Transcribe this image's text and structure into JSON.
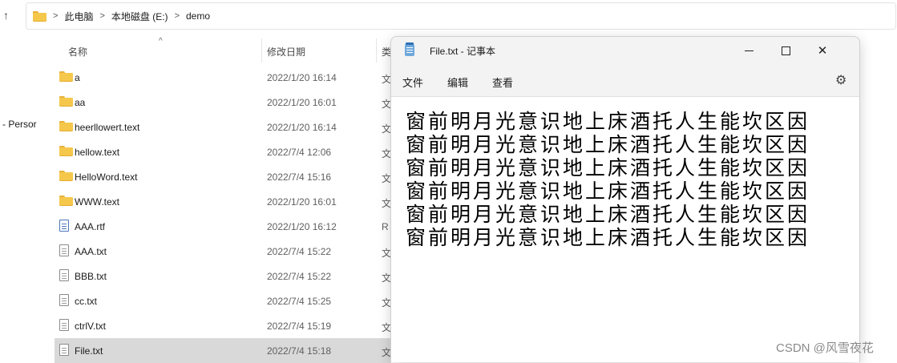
{
  "explorer": {
    "breadcrumb": [
      "此电脑",
      "本地磁盘 (E:)",
      "demo"
    ],
    "left_nav_text": "- Persor",
    "columns": {
      "name": "名称",
      "date": "修改日期",
      "type": "类"
    },
    "files": [
      {
        "name": "a",
        "date": "2022/1/20 16:14",
        "type": "文",
        "icon": "folder-icon"
      },
      {
        "name": "aa",
        "date": "2022/1/20 16:01",
        "type": "文",
        "icon": "folder-icon"
      },
      {
        "name": "heerllowert.text",
        "date": "2022/1/20 16:14",
        "type": "文",
        "icon": "folder-icon"
      },
      {
        "name": "hellow.text",
        "date": "2022/7/4 12:06",
        "type": "文",
        "icon": "folder-icon"
      },
      {
        "name": "HelloWord.text",
        "date": "2022/7/4 15:16",
        "type": "文",
        "icon": "folder-icon"
      },
      {
        "name": "WWW.text",
        "date": "2022/1/20 16:01",
        "type": "文",
        "icon": "folder-icon"
      },
      {
        "name": "AAA.rtf",
        "date": "2022/1/20 16:12",
        "type": "R",
        "icon": "rtf-file-icon"
      },
      {
        "name": "AAA.txt",
        "date": "2022/7/4 15:22",
        "type": "文",
        "icon": "text-file-icon"
      },
      {
        "name": "BBB.txt",
        "date": "2022/7/4 15:22",
        "type": "文",
        "icon": "text-file-icon"
      },
      {
        "name": "cc.txt",
        "date": "2022/7/4 15:25",
        "type": "文",
        "icon": "text-file-icon"
      },
      {
        "name": "ctrlV.txt",
        "date": "2022/7/4 15:19",
        "type": "文",
        "icon": "text-file-icon"
      },
      {
        "name": "File.txt",
        "date": "2022/7/4 15:18",
        "type": "文",
        "icon": "text-file-icon",
        "selected": true
      }
    ]
  },
  "notepad": {
    "title": "File.txt - 记事本",
    "menu": {
      "file": "文件",
      "edit": "编辑",
      "view": "查看"
    },
    "lines": [
      "窗前明月光意识地上床酒托人生能坎区因",
      "窗前明月光意识地上床酒托人生能坎区因",
      "窗前明月光意识地上床酒托人生能坎区因",
      "窗前明月光意识地上床酒托人生能坎区因",
      "窗前明月光意识地上床酒托人生能坎区因",
      "窗前明月光意识地上床酒托人生能坎区因"
    ]
  },
  "watermark": "CSDN @风雪夜花",
  "colors": {
    "folder": "#f5c84c",
    "selected_row": "#d9d9d9",
    "notepad_bg": "#f3f3f3"
  }
}
